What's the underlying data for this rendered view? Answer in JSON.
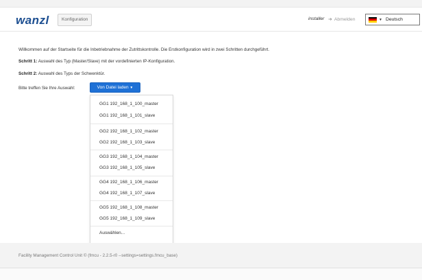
{
  "header": {
    "logo": "wanzl",
    "config_button": "Konfiguration",
    "user": "installer",
    "logout_label": "Abmelden",
    "language": "Deutsch"
  },
  "content": {
    "welcome": "Willkommen auf der Startseite für die Inbetriebnahme der Zutrittskontrolle. Die Erstkonfiguration wird in zwei Schritten durchgeführt.",
    "step1_label": "Schritt 1:",
    "step1_text": " Auswahl des Typ (Master/Slave) mit der vordefinierten IP-Konfiguration.",
    "step2_label": "Schritt 2:",
    "step2_text": " Auswahl des Typs der Schwenktür.",
    "choice_label": "Bitte treffen Sie Ihre Auswahl:",
    "dropdown_button": "Von Datei laden",
    "dropdown_items": [
      "GG1 192_168_1_100_master",
      "GG1 192_168_1_101_slave",
      "GG2 192_168_1_102_master",
      "GG2 192_168_1_103_slave",
      "GG3 192_168_1_104_master",
      "GG3 192_168_1_105_slave",
      "GG4 192_168_1_106_master",
      "GG4 192_168_1_107_slave",
      "GG5 192_168_1_108_master",
      "GG5 192_168_1_109_slave",
      "Auswählen..."
    ]
  },
  "footer": {
    "text": "Facility Management Control Unit © (fmcu - 2.2.5-r0 --settings=settings.fmcu_base)"
  },
  "colors": {
    "brand": "#1d4f91",
    "button_primary": "#1f71d6"
  },
  "icons": {
    "logout": "sign-out-icon",
    "flag": "german-flag-icon",
    "caret": "caret-down-icon"
  }
}
